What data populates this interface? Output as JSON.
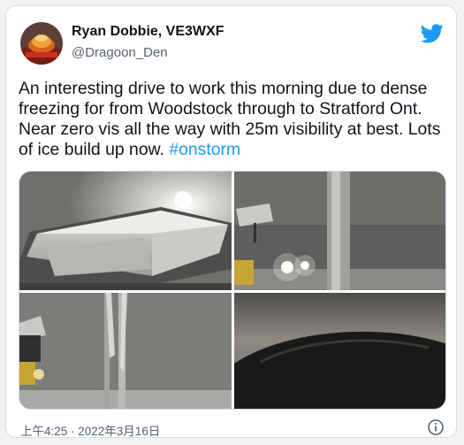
{
  "author": {
    "name": "Ryan Dobbie, VE3WXF",
    "handle": "@Dragoon_Den"
  },
  "tweet": {
    "text": "An interesting drive to work this morning due to dense freezing for from Woodstock through to Stratford Ont. Near zero vis all the way with 25m visibility at best. Lots of ice build up now. ",
    "hashtag": "#onstorm",
    "timestamp": "上午4:25 · 2022年3月16日"
  },
  "icons": {
    "brand": "twitter-bird-icon",
    "info": "info-icon"
  },
  "colors": {
    "accent": "#1d9bf0",
    "text": "#0f1419",
    "secondary": "#536471"
  },
  "media": {
    "photo_count": 4
  }
}
